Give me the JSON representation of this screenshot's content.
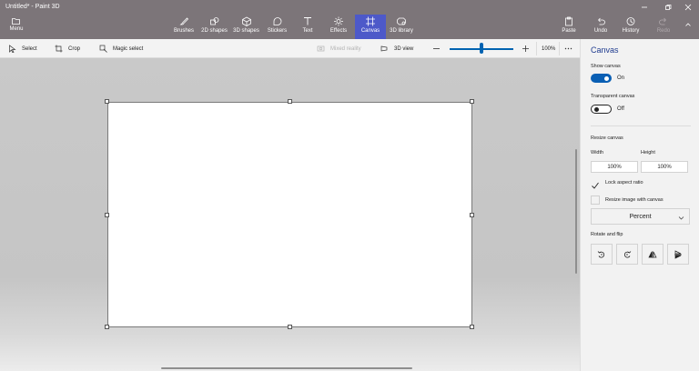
{
  "window": {
    "title": "Untitled* - Paint 3D"
  },
  "menu": {
    "label": "Menu"
  },
  "ribbon": {
    "tools": [
      "Brushes",
      "2D shapes",
      "3D shapes",
      "Stickers",
      "Text",
      "Effects",
      "Canvas",
      "3D library"
    ],
    "active_tool": "Canvas",
    "right_tools": [
      "Paste",
      "Undo",
      "History",
      "Redo"
    ]
  },
  "toolbar": {
    "select": "Select",
    "crop": "Crop",
    "magic_select": "Magic select",
    "mixed_reality": "Mixed reality",
    "view_3d": "3D view",
    "zoom_value": "100%",
    "zoom_level_percent": 100
  },
  "panel": {
    "title": "Canvas",
    "show_canvas_label": "Show canvas",
    "show_canvas_state": "On",
    "transparent_canvas_label": "Transparent canvas",
    "transparent_canvas_state": "Off",
    "resize_canvas_label": "Resize canvas",
    "width_label": "Width",
    "height_label": "Height",
    "width_value": "100%",
    "height_value": "100%",
    "lock_aspect_label": "Lock aspect ratio",
    "lock_aspect_checked": true,
    "resize_image_label": "Resize image with canvas",
    "resize_image_checked": false,
    "units_selected": "Percent",
    "rotate_flip_label": "Rotate and flip"
  },
  "colors": {
    "ribbon_bg": "#7c7579",
    "active_tool_bg": "#4d59c9",
    "accent": "#0a5fb4",
    "panel_title": "#1f3b8f"
  }
}
